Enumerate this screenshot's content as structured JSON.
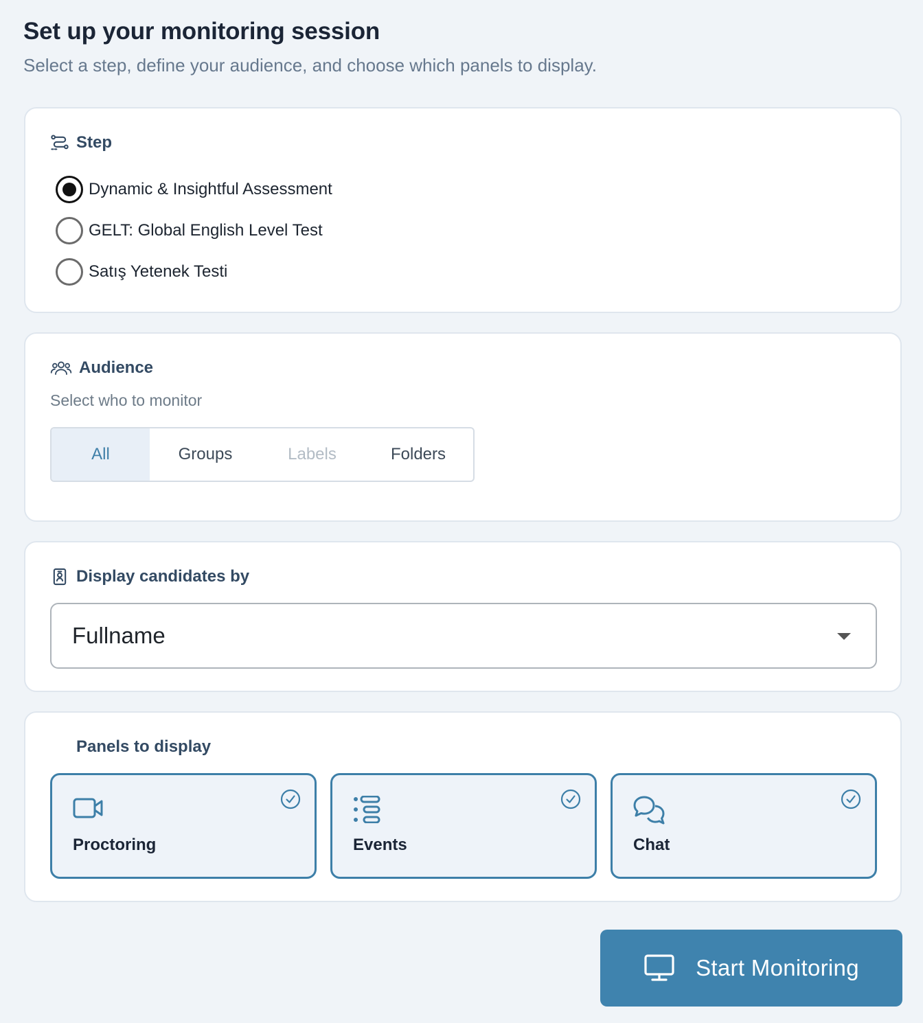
{
  "header": {
    "title": "Set up your monitoring session",
    "subtitle": "Select a step, define your audience, and choose which panels to display."
  },
  "step": {
    "heading": "Step",
    "icon": "route-icon",
    "options": [
      {
        "label": "Dynamic & Insightful Assessment",
        "checked": true
      },
      {
        "label": "GELT: Global English Level Test",
        "checked": false
      },
      {
        "label": "Satış Yetenek Testi",
        "checked": false
      }
    ]
  },
  "audience": {
    "heading": "Audience",
    "icon": "users-icon",
    "description": "Select who to monitor",
    "segments": [
      {
        "label": "All",
        "state": "active"
      },
      {
        "label": "Groups",
        "state": "normal"
      },
      {
        "label": "Labels",
        "state": "disabled"
      },
      {
        "label": "Folders",
        "state": "normal"
      }
    ]
  },
  "display": {
    "heading": "Display candidates by",
    "icon": "id-badge-icon",
    "selected": "Fullname"
  },
  "panels": {
    "heading": "Panels to display",
    "items": [
      {
        "label": "Proctoring",
        "icon": "video-camera-icon",
        "checked": true
      },
      {
        "label": "Events",
        "icon": "list-icon",
        "checked": true
      },
      {
        "label": "Chat",
        "icon": "chat-bubbles-icon",
        "checked": true
      }
    ]
  },
  "actions": {
    "start_label": "Start Monitoring",
    "start_icon": "monitor-icon"
  },
  "colors": {
    "background": "#f0f4f8",
    "accent": "#3f83ae",
    "heading": "#334a63",
    "tile_bg": "#eef3f9",
    "tile_border": "#3d7fa8"
  }
}
